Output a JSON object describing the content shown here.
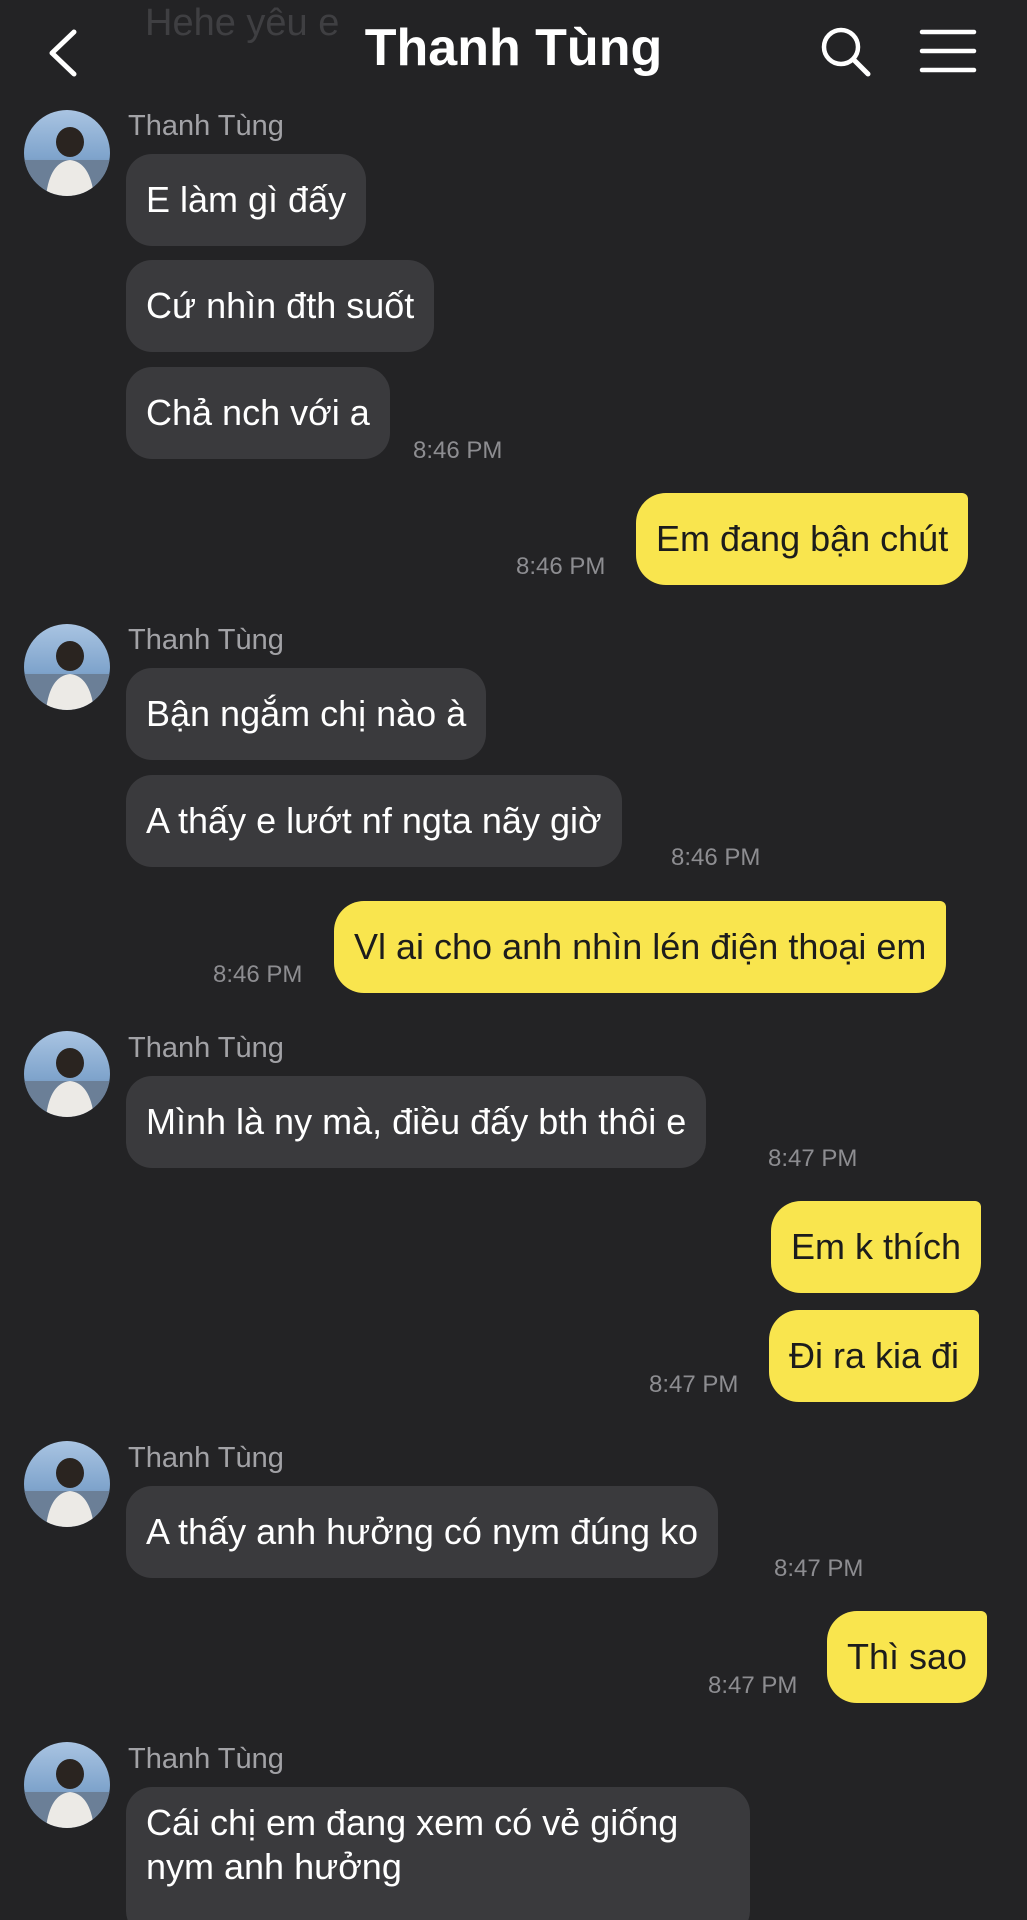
{
  "header": {
    "previous_snippet": "Hehe yêu e",
    "title": "Thanh Tùng"
  },
  "messages": {
    "g1": {
      "sender": "Thanh Tùng",
      "m1": "E làm gì đấy",
      "m2": "Cứ nhìn đth suốt",
      "m3": "Chả nch với a",
      "time": "8:46 PM"
    },
    "o1": {
      "text": "Em đang bận chút",
      "time": "8:46 PM"
    },
    "g2": {
      "sender": "Thanh Tùng",
      "m1": "Bận ngắm chị nào à",
      "m2": "A thấy e lướt nf ngta nãy giờ",
      "time": "8:46 PM"
    },
    "o2": {
      "text": "Vl ai cho anh nhìn lén điện thoại em",
      "time": "8:46 PM"
    },
    "g3": {
      "sender": "Thanh Tùng",
      "m1": "Mình là ny mà, điều đấy bth thôi e",
      "time": "8:47 PM"
    },
    "o3": {
      "m1": "Em k thích",
      "m2": "Đi ra kia đi",
      "time": "8:47 PM"
    },
    "g4": {
      "sender": "Thanh Tùng",
      "m1": "A thấy anh hưởng có nym đúng ko",
      "time": "8:47 PM"
    },
    "o4": {
      "text": "Thì sao",
      "time": "8:47 PM"
    },
    "g5": {
      "sender": "Thanh Tùng",
      "line1": "Cái chị em đang xem có vẻ giống",
      "line2": "nym anh hưởng"
    }
  },
  "colors": {
    "background": "#232325",
    "incoming_bubble": "#3a3a3d",
    "outgoing_bubble": "#f9e54e"
  },
  "icons": [
    "back-arrow-icon",
    "search-icon",
    "hamburger-menu-icon",
    "avatar"
  ]
}
